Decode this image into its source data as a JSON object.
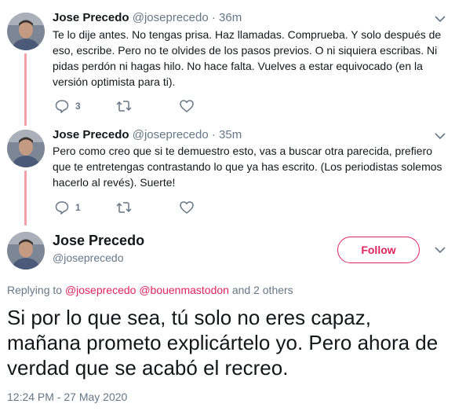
{
  "tweets": [
    {
      "name": "Jose Precedo",
      "handle": "@joseprecedo",
      "dot": "·",
      "time": "36m",
      "text": "Te lo dije antes. No tengas prisa. Haz llamadas. Comprueba. Y solo después de eso, escribe. Pero no te olvides de los pasos previos. O ni siquiera escribas. Ni pidas perdón ni hagas hilo. No hace falta. Vuelves a estar equivocado (en la versión optimista para ti).",
      "reply_count": "3",
      "retweet_count": "",
      "like_count": ""
    },
    {
      "name": "Jose Precedo",
      "handle": "@joseprecedo",
      "dot": "·",
      "time": "35m",
      "text": "Pero como creo que si te demuestro esto, vas a buscar otra parecida, prefiero que te entretengas contrastando lo que ya has escrito. (Los periodistas solemos hacerlo al revés). Suerte!",
      "reply_count": "1",
      "retweet_count": "",
      "like_count": ""
    }
  ],
  "main_tweet": {
    "name": "Jose Precedo",
    "handle": "@joseprecedo",
    "follow_label": "Follow",
    "replying_prefix": "Replying to",
    "mention_1": "@joseprecedo",
    "mention_2": "@bouenmastodon",
    "replying_suffix": "and 2 others",
    "text": "Si por lo que sea, tú solo no eres capaz, mañana prometo explicártelo yo. Pero ahora de verdad que se acabó el recreo.",
    "timestamp": "12:24 PM - 27 May 2020"
  },
  "colors": {
    "accent": "#e0245e",
    "thread_line": "#f4a0a8",
    "secondary_text": "#657786",
    "primary_text": "#14171a"
  },
  "icons": {
    "reply": "reply-icon",
    "retweet": "retweet-icon",
    "like": "heart-icon",
    "caret": "chevron-down-icon",
    "avatar": "avatar"
  }
}
